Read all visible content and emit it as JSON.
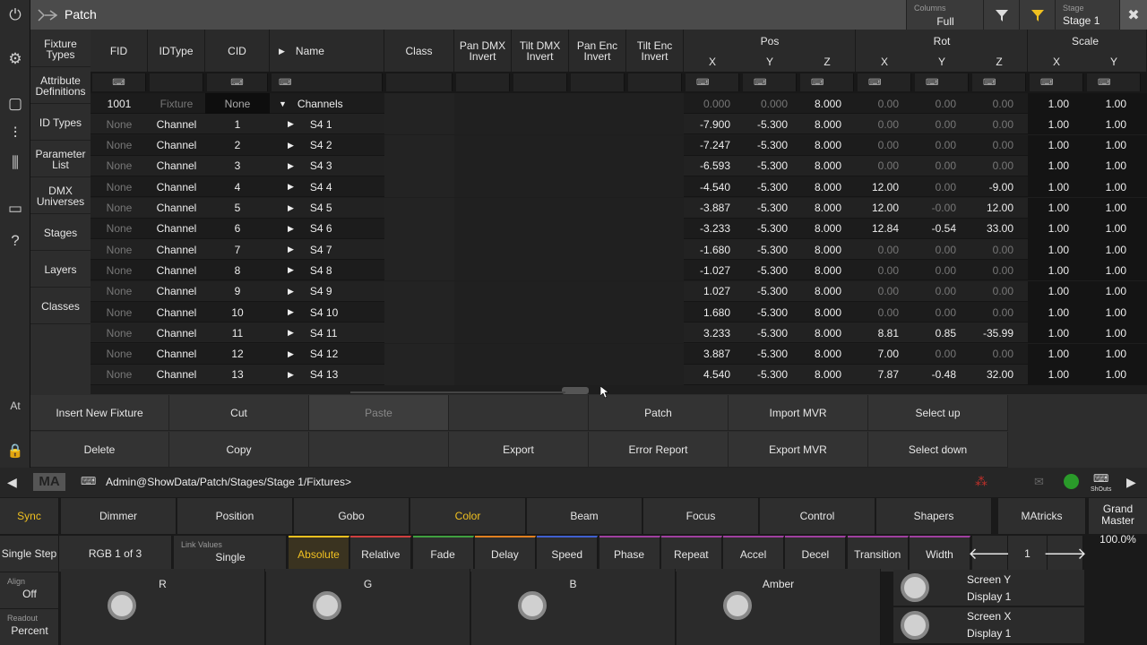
{
  "title": "Patch",
  "header": {
    "columns_label": "Columns",
    "columns_value": "Full",
    "stage_label": "Stage",
    "stage_value": "Stage 1"
  },
  "sidenav": [
    "Fixture Types",
    "Attribute Definitions",
    "ID Types",
    "Parameter List",
    "DMX Universes",
    "Stages",
    "Layers",
    "Classes"
  ],
  "table": {
    "headers": {
      "fid": "FID",
      "idtype": "IDType",
      "cid": "CID",
      "name": "Name",
      "class": "Class",
      "pan_dmx": "Pan DMX Invert",
      "tilt_dmx": "Tilt DMX Invert",
      "pan_enc": "Pan Enc Invert",
      "tilt_enc": "Tilt Enc Invert"
    },
    "groups": {
      "pos": "Pos",
      "rot": "Rot",
      "scale": "Scale"
    },
    "axes": [
      "X",
      "Y",
      "Z",
      "X",
      "Y",
      "Z",
      "X",
      "Y"
    ],
    "rows": [
      {
        "fid": "1001",
        "idtype": "Fixture",
        "cid": "None",
        "name": "Channels",
        "px": "0.000",
        "py": "0.000",
        "pz": "8.000",
        "rx": "0.00",
        "ry": "0.00",
        "rz": "0.00",
        "sx": "1.00",
        "sy": "1.00"
      },
      {
        "fid": "None",
        "idtype": "Channel",
        "cid": "1",
        "name": "S4 1",
        "px": "-7.900",
        "py": "-5.300",
        "pz": "8.000",
        "rx": "0.00",
        "ry": "0.00",
        "rz": "0.00",
        "sx": "1.00",
        "sy": "1.00"
      },
      {
        "fid": "None",
        "idtype": "Channel",
        "cid": "2",
        "name": "S4 2",
        "px": "-7.247",
        "py": "-5.300",
        "pz": "8.000",
        "rx": "0.00",
        "ry": "0.00",
        "rz": "0.00",
        "sx": "1.00",
        "sy": "1.00"
      },
      {
        "fid": "None",
        "idtype": "Channel",
        "cid": "3",
        "name": "S4 3",
        "px": "-6.593",
        "py": "-5.300",
        "pz": "8.000",
        "rx": "0.00",
        "ry": "0.00",
        "rz": "0.00",
        "sx": "1.00",
        "sy": "1.00"
      },
      {
        "fid": "None",
        "idtype": "Channel",
        "cid": "4",
        "name": "S4 4",
        "px": "-4.540",
        "py": "-5.300",
        "pz": "8.000",
        "rx": "12.00",
        "ry": "0.00",
        "rz": "-9.00",
        "sx": "1.00",
        "sy": "1.00"
      },
      {
        "fid": "None",
        "idtype": "Channel",
        "cid": "5",
        "name": "S4 5",
        "px": "-3.887",
        "py": "-5.300",
        "pz": "8.000",
        "rx": "12.00",
        "ry": "-0.00",
        "rz": "12.00",
        "sx": "1.00",
        "sy": "1.00"
      },
      {
        "fid": "None",
        "idtype": "Channel",
        "cid": "6",
        "name": "S4 6",
        "px": "-3.233",
        "py": "-5.300",
        "pz": "8.000",
        "rx": "12.84",
        "ry": "-0.54",
        "rz": "33.00",
        "sx": "1.00",
        "sy": "1.00"
      },
      {
        "fid": "None",
        "idtype": "Channel",
        "cid": "7",
        "name": "S4 7",
        "px": "-1.680",
        "py": "-5.300",
        "pz": "8.000",
        "rx": "0.00",
        "ry": "0.00",
        "rz": "0.00",
        "sx": "1.00",
        "sy": "1.00"
      },
      {
        "fid": "None",
        "idtype": "Channel",
        "cid": "8",
        "name": "S4 8",
        "px": "-1.027",
        "py": "-5.300",
        "pz": "8.000",
        "rx": "0.00",
        "ry": "0.00",
        "rz": "0.00",
        "sx": "1.00",
        "sy": "1.00"
      },
      {
        "fid": "None",
        "idtype": "Channel",
        "cid": "9",
        "name": "S4 9",
        "px": "1.027",
        "py": "-5.300",
        "pz": "8.000",
        "rx": "0.00",
        "ry": "0.00",
        "rz": "0.00",
        "sx": "1.00",
        "sy": "1.00"
      },
      {
        "fid": "None",
        "idtype": "Channel",
        "cid": "10",
        "name": "S4 10",
        "px": "1.680",
        "py": "-5.300",
        "pz": "8.000",
        "rx": "0.00",
        "ry": "0.00",
        "rz": "0.00",
        "sx": "1.00",
        "sy": "1.00"
      },
      {
        "fid": "None",
        "idtype": "Channel",
        "cid": "11",
        "name": "S4 11",
        "px": "3.233",
        "py": "-5.300",
        "pz": "8.000",
        "rx": "8.81",
        "ry": "0.85",
        "rz": "-35.99",
        "sx": "1.00",
        "sy": "1.00"
      },
      {
        "fid": "None",
        "idtype": "Channel",
        "cid": "12",
        "name": "S4 12",
        "px": "3.887",
        "py": "-5.300",
        "pz": "8.000",
        "rx": "7.00",
        "ry": "0.00",
        "rz": "0.00",
        "sx": "1.00",
        "sy": "1.00"
      },
      {
        "fid": "None",
        "idtype": "Channel",
        "cid": "13",
        "name": "S4 13",
        "px": "4.540",
        "py": "-5.300",
        "pz": "8.000",
        "rx": "7.87",
        "ry": "-0.48",
        "rz": "32.00",
        "sx": "1.00",
        "sy": "1.00"
      }
    ]
  },
  "actions": {
    "insert": "Insert New Fixture",
    "cut": "Cut",
    "paste": "Paste",
    "patch": "Patch",
    "import_mvr": "Import MVR",
    "select_up": "Select up",
    "delete": "Delete",
    "copy": "Copy",
    "export": "Export",
    "error_report": "Error Report",
    "export_mvr": "Export MVR",
    "select_down": "Select down"
  },
  "cmdline": {
    "logo": "MA",
    "path": "Admin@ShowData/Patch/Stages/Stage 1/Fixtures>",
    "shouts": "ShOuts",
    "at": "At"
  },
  "presets": {
    "sync": "Sync",
    "types": [
      "Dimmer",
      "Position",
      "Gobo",
      "Color",
      "Beam",
      "Focus",
      "Control",
      "Shapers"
    ],
    "matricks": "MAtricks",
    "grand_master": "Grand Master",
    "grand_value": "100.0%",
    "single_step": "Single Step",
    "rgb": "RGB 1 of 3",
    "link_label": "Link Values",
    "link_value": "Single",
    "modes": [
      "Absolute",
      "Relative",
      "Fade",
      "Delay",
      "Speed",
      "Phase",
      "Repeat",
      "Accel",
      "Decel",
      "Transition",
      "Width"
    ],
    "page": "1",
    "align_label": "Align",
    "align_value": "Off",
    "readout_label": "Readout",
    "readout_value": "Percent",
    "encoders": [
      "R",
      "G",
      "B",
      "Amber"
    ],
    "screen_y": "Screen Y",
    "display_y": "Display 1",
    "screen_x": "Screen X",
    "display_x": "Display 1"
  },
  "colors": {
    "accent": "#f0c020",
    "active_preset": "#f0c020"
  }
}
